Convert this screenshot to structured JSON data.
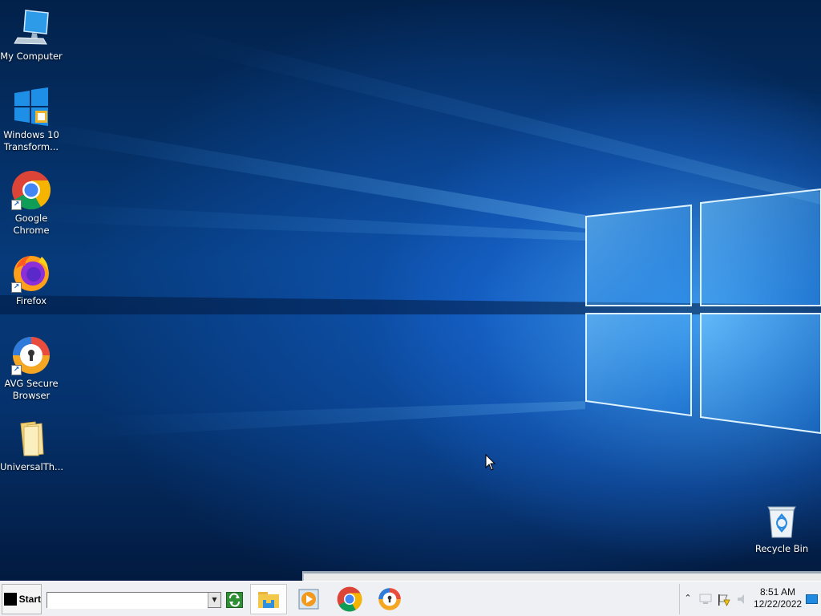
{
  "desktop": {
    "icons": [
      {
        "label": "My Computer",
        "icon": "computer-icon"
      },
      {
        "label": "Windows 10 Transform...",
        "icon": "windows-logo-icon"
      },
      {
        "label": "Google Chrome",
        "icon": "chrome-icon",
        "shortcut": true
      },
      {
        "label": "Firefox",
        "icon": "firefox-icon",
        "shortcut": true
      },
      {
        "label": "AVG Secure Browser",
        "icon": "avg-browser-icon",
        "shortcut": true
      },
      {
        "label": "UniversalTh...",
        "icon": "folder-icon"
      }
    ],
    "recycle_bin": {
      "label": "Recycle Bin",
      "icon": "recycle-bin-icon"
    }
  },
  "taskbar": {
    "start_label": "Start",
    "run_input_value": "",
    "go_icon": "go-arrows-icon",
    "pinned_apps": [
      {
        "name": "File Explorer",
        "icon": "file-explorer-icon",
        "active": true
      },
      {
        "name": "Media Player",
        "icon": "media-player-icon",
        "active": false
      },
      {
        "name": "Google Chrome",
        "icon": "chrome-icon",
        "active": false
      },
      {
        "name": "AVG Secure Browser",
        "icon": "avg-browser-icon",
        "active": false
      }
    ],
    "tray": {
      "expand_icon": "chevron-up-icon",
      "icons": [
        "network-icon",
        "action-center-flag-icon",
        "volume-icon"
      ],
      "time": "8:51 AM",
      "date": "12/22/2022",
      "show_desktop_icon": "show-desktop-icon"
    }
  },
  "colors": {
    "taskbar_bg": "#eef0f3",
    "wallpaper_light": "#46aaff",
    "wallpaper_dark": "#02214a"
  }
}
